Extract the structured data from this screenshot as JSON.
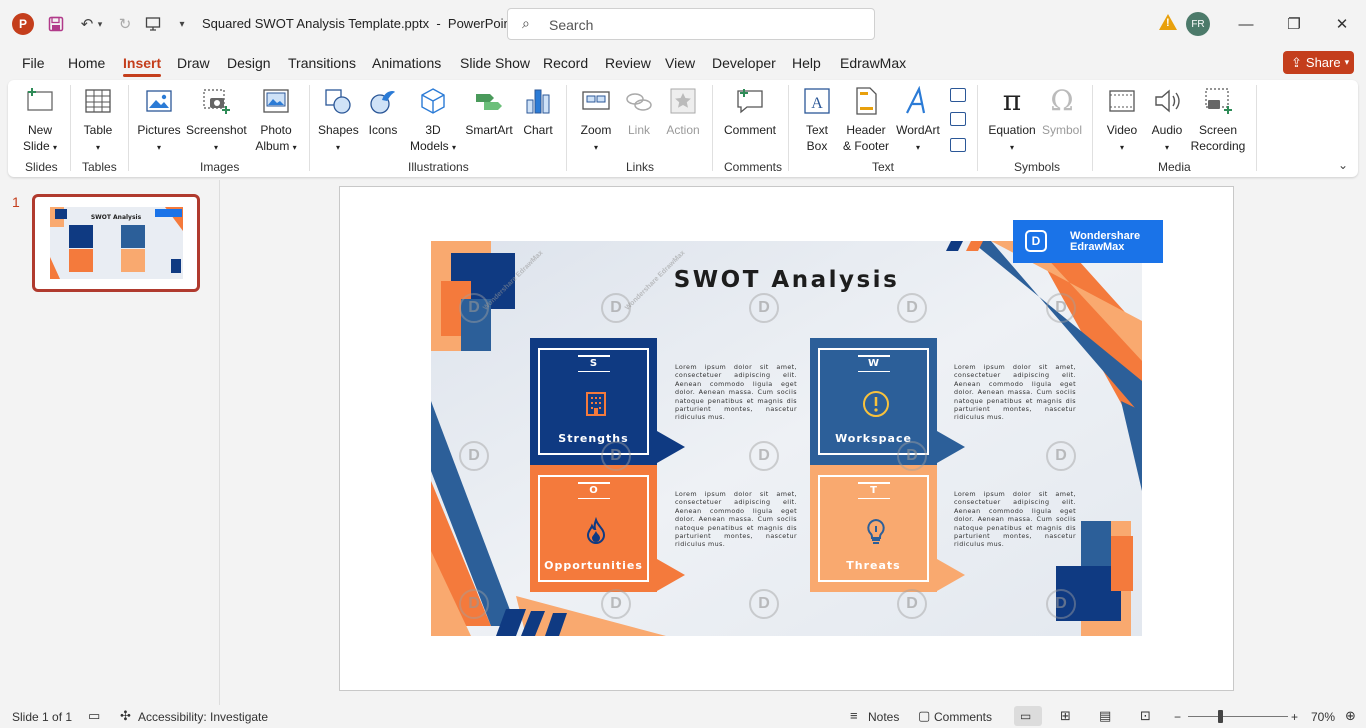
{
  "titlebar": {
    "app_logo_letter": "P",
    "doc_title": "Squared SWOT Analysis Template.pptx  -  PowerPoint",
    "search_placeholder": "Search",
    "avatar_initials": "FR"
  },
  "tabs": [
    "File",
    "Home",
    "Insert",
    "Draw",
    "Design",
    "Transitions",
    "Animations",
    "Slide Show",
    "Record",
    "Review",
    "View",
    "Developer",
    "Help",
    "EdrawMax"
  ],
  "active_tab": "Insert",
  "share_label": "Share",
  "ribbon": {
    "groups": {
      "slides": "Slides",
      "tables": "Tables",
      "images": "Images",
      "illustrations": "Illustrations",
      "links": "Links",
      "comments": "Comments",
      "text": "Text",
      "symbols": "Symbols",
      "media": "Media"
    },
    "buttons": {
      "new_slide_1": "New",
      "new_slide_2": "Slide",
      "table": "Table",
      "pictures": "Pictures",
      "screenshot": "Screenshot",
      "photo_album_1": "Photo",
      "photo_album_2": "Album",
      "shapes": "Shapes",
      "icons": "Icons",
      "models_1": "3D",
      "models_2": "Models",
      "smartart": "SmartArt",
      "chart": "Chart",
      "zoom": "Zoom",
      "link": "Link",
      "action": "Action",
      "comment": "Comment",
      "text_box_1": "Text",
      "text_box_2": "Box",
      "header_footer_1": "Header",
      "header_footer_2": "& Footer",
      "wordart": "WordArt",
      "equation": "Equation",
      "symbol": "Symbol",
      "video": "Video",
      "audio": "Audio",
      "screen_recording_1": "Screen",
      "screen_recording_2": "Recording"
    }
  },
  "thumbnails": {
    "slide_number": "1",
    "thumb_title": "SWOT Analysis"
  },
  "slide": {
    "title": "SWOT Analysis",
    "logo_line1": "Wondershare",
    "logo_line2": "EdrawMax",
    "watermark_text": "Wondershare EdrawMax",
    "quadrants": [
      {
        "letter": "S",
        "label": "Strengths",
        "color": "#0f3a82",
        "text": "Lorem ipsum dolor sit amet, consectetuer adipiscing elit. Aenean commodo ligula eget dolor. Aenean massa. Cum sociis natoque penatibus et magnis dis parturient montes, nascetur ridiculus mus."
      },
      {
        "letter": "W",
        "label": "Workspace",
        "color": "#2c5f99",
        "text": "Lorem ipsum dolor sit amet, consectetuer adipiscing elit. Aenean commodo ligula eget dolor. Aenean massa. Cum sociis natoque penatibus et magnis dis parturient montes, nascetur ridiculus mus."
      },
      {
        "letter": "O",
        "label": "Opportunities",
        "color": "#f47a3c",
        "text": "Lorem ipsum dolor sit amet, consectetuer adipiscing elit. Aenean commodo ligula eget dolor. Aenean massa. Cum sociis natoque penatibus et magnis dis parturient montes, nascetur ridiculus mus."
      },
      {
        "letter": "T",
        "label": "Threats",
        "color": "#f9a96f",
        "text": "Lorem ipsum dolor sit amet, consectetuer adipiscing elit. Aenean commodo ligula eget dolor. Aenean massa. Cum sociis natoque penatibus et magnis dis parturient montes, nascetur ridiculus mus."
      }
    ]
  },
  "statusbar": {
    "slide_info": "Slide 1 of 1",
    "accessibility": "Accessibility: Investigate",
    "notes": "Notes",
    "comments": "Comments",
    "zoom": "70%",
    "zoom_minus": "−",
    "zoom_plus": "+"
  },
  "colors": {
    "accent": "#c43e1c",
    "navy": "#0f3a82",
    "orange": "#f47a3c",
    "peach": "#f9a96f"
  }
}
